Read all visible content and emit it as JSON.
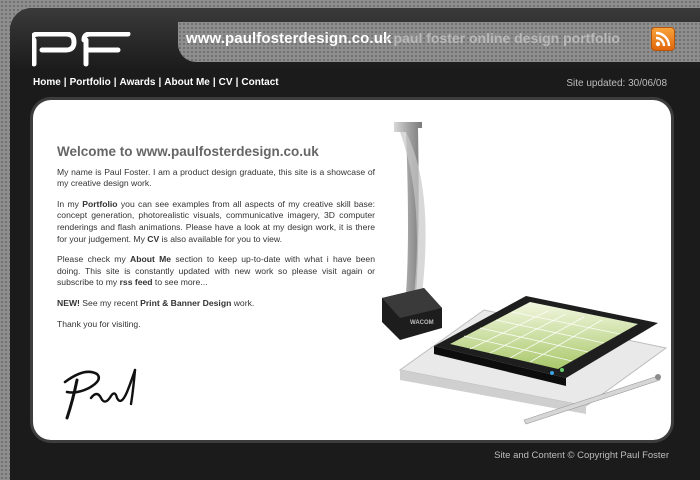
{
  "header": {
    "domain": "www.paulfosterdesign.co.uk",
    "tagline": "- paul foster online design portfolio",
    "logo_icon": "pf-logo-icon",
    "rss_icon": "rss-feed-icon",
    "rss_color": "#f28c28"
  },
  "nav": {
    "items": [
      {
        "label": "Home"
      },
      {
        "label": "Portfolio"
      },
      {
        "label": "Awards"
      },
      {
        "label": "About Me"
      },
      {
        "label": "CV"
      },
      {
        "label": "Contact"
      }
    ],
    "separator": "|"
  },
  "status": {
    "updated": "Site updated: 30/06/08"
  },
  "content": {
    "title": "Welcome to www.paulfosterdesign.co.uk",
    "p1": "My name is Paul Foster. I am a product design graduate, this site is a showcase of my creative design work.",
    "p2": {
      "a": "In my ",
      "portfolio": "Portfolio",
      "b": " you can see examples from all aspects of my creative skill base: concept generation, photorealistic visuals, communicative imagery, 3D computer renderings and flash animations. Please have a look at my design work, it is there for your judgement. My ",
      "cv": "CV",
      "c": " is also available for you to view."
    },
    "p3": {
      "a": "Please check my ",
      "about": "About Me",
      "b": " section to keep up-to-date with what i have been doing. This site is constantly updated with new work so please visit again or subscribe to my ",
      "rss": "rss feed",
      "c": " to see more..."
    },
    "p4": {
      "new": "NEW!",
      "a": " See my recent ",
      "link": "Print & Banner Design",
      "b": " work."
    },
    "p5": "Thank you for visiting.",
    "signature_icon": "handwritten-signature-icon"
  },
  "product": {
    "image_icon": "product-render-icon",
    "device_label": "WACOM"
  },
  "footer": {
    "copyright": "Site and Content © Copyright Paul Foster"
  }
}
